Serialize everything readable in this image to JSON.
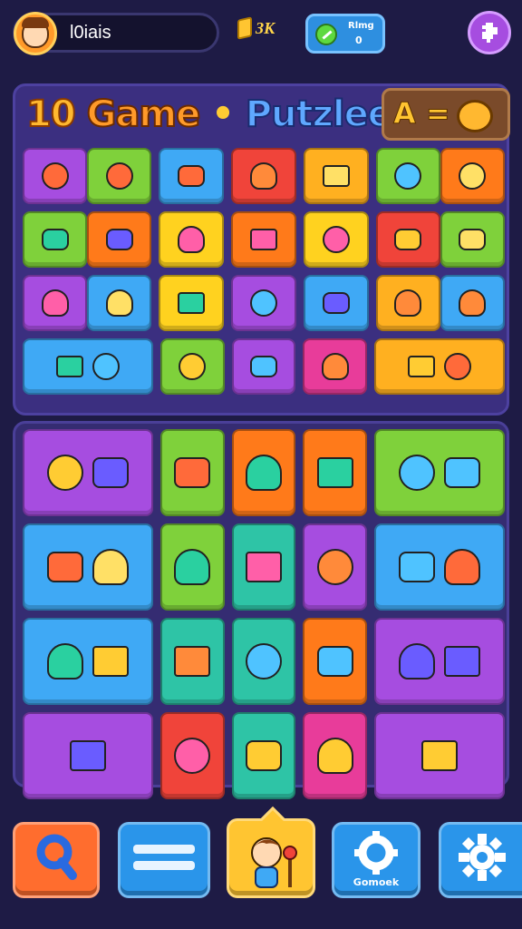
{
  "header": {
    "player_name": "l0iais",
    "currency_value": "ЗК",
    "gem_box": {
      "label": "Rlmg",
      "value": "0"
    }
  },
  "panel": {
    "title_number": "10",
    "title_game": "Game",
    "title_dot": "•",
    "title_word": "Putzlee",
    "badge_text": "A ="
  },
  "colors": {
    "background": "#1e1b45",
    "panel": "#3b2f80",
    "accent_orange": "#ff9a2a",
    "accent_blue": "#5fa8ff",
    "tile_palette": [
      "#a64de0",
      "#7fd13b",
      "#3fa9f5",
      "#f0443a",
      "#ffb020",
      "#ff7a1a",
      "#ffd21f",
      "#e83c9a",
      "#2ec4a6"
    ]
  },
  "grid_top": [
    [
      {
        "c": "#a64de0",
        "icons": [
          "lamp-icon"
        ],
        "c2": "#7fd13b",
        "icons2": [
          "tool-icon"
        ]
      },
      {
        "c": "#3fa9f5",
        "icons": [
          "bag-icon"
        ]
      },
      {
        "c": "#f0443a",
        "icons": [
          "cassette-icon"
        ]
      },
      {
        "c": "#ffb020",
        "icons": [
          "table-icon"
        ]
      },
      {
        "c": "#7fd13b",
        "icons": [
          "paper-icon"
        ],
        "c2": "#ff7a1a",
        "icons2": [
          "card-icon"
        ]
      }
    ],
    [
      {
        "c": "#7fd13b",
        "icons": [
          "cross-icon"
        ],
        "c2": "#ff7a1a",
        "icons2": [
          "book-icon"
        ]
      },
      {
        "c": "#ffd21f",
        "icons": [
          "brush-icon"
        ]
      },
      {
        "c": "#ff7a1a",
        "icons": [
          "lens-icon"
        ]
      },
      {
        "c": "#ffd21f",
        "icons": [
          "car-icon"
        ]
      },
      {
        "c": "#f0443a",
        "icons": [
          "flower-icon"
        ],
        "c2": "#7fd13b",
        "icons2": [
          "cup-icon"
        ]
      }
    ],
    [
      {
        "c": "#a64de0",
        "icons": [
          "torch-icon"
        ],
        "c2": "#3fa9f5",
        "icons2": [
          "hammer-icon"
        ]
      },
      {
        "c": "#ffd21f",
        "icons": [
          "box-icon"
        ]
      },
      {
        "c": "#a64de0",
        "icons": [
          "robot-icon"
        ]
      },
      {
        "c": "#3fa9f5",
        "icons": [
          "popsicle-icon"
        ]
      },
      {
        "c": "#ffb020",
        "icons": [
          "cube-icon"
        ],
        "c2": "#3fa9f5",
        "icons2": [
          "fish-icon"
        ]
      }
    ],
    [
      {
        "c": "#3fa9f5",
        "icons": [
          "kid-icon",
          "photo-icon"
        ],
        "wide": true
      },
      {
        "c": "#7fd13b",
        "icons": [
          "capsule-icon"
        ]
      },
      {
        "c": "#a64de0",
        "icons": [
          "horn-icon"
        ]
      },
      {
        "c": "#e83c9a",
        "icons": [
          "bell-icon"
        ]
      },
      {
        "c": "#ffb020",
        "icons": [
          "girl-icon",
          "ring-icon"
        ],
        "wide": true
      }
    ]
  ],
  "grid_bottom": [
    [
      {
        "c": "#a64de0",
        "icons": [
          "kid-icon",
          "lamp-icon"
        ],
        "wide": true
      },
      {
        "c": "#7fd13b",
        "icons": [
          "bus-icon"
        ]
      },
      {
        "c": "#ff7a1a",
        "icons": [
          "fish-icon"
        ]
      },
      {
        "c": "#ff7a1a",
        "icons": [
          "pen-icon"
        ]
      },
      {
        "c": "#7fd13b",
        "icons": [
          "paper-icon",
          "bulb-icon"
        ],
        "wide": true
      }
    ],
    [
      {
        "c": "#3fa9f5",
        "icons": [
          "kid-icon",
          "rattle-icon"
        ],
        "wide": true
      },
      {
        "c": "#7fd13b",
        "icons": [
          "drum-icon"
        ]
      },
      {
        "c": "#2ec4a6",
        "icons": [
          "seal-icon"
        ]
      },
      {
        "c": "#a64de0",
        "icons": [
          "cheese-icon"
        ]
      },
      {
        "c": "#3fa9f5",
        "icons": [
          "ball-icon",
          "hammer-icon"
        ],
        "wide": true
      }
    ],
    [
      {
        "c": "#3fa9f5",
        "icons": [
          "girl-icon",
          "umbrella-icon"
        ],
        "wide": true
      },
      {
        "c": "#2ec4a6",
        "icons": [
          "balloon-icon"
        ]
      },
      {
        "c": "#2ec4a6",
        "icons": [
          "lemon-icon"
        ]
      },
      {
        "c": "#ff7a1a",
        "icons": [
          "cube-icon"
        ]
      },
      {
        "c": "#a64de0",
        "icons": [
          "monster-icon",
          "bucket-icon"
        ],
        "wide": true
      }
    ],
    [
      {
        "c": "#a64de0",
        "icons": [
          "skateboard-icon"
        ],
        "wide": true
      },
      {
        "c": "#f0443a",
        "icons": [
          "car-icon"
        ]
      },
      {
        "c": "#2ec4a6",
        "icons": [
          "bubble-icon"
        ]
      },
      {
        "c": "#e83c9a",
        "icons": [
          "chest-icon"
        ]
      },
      {
        "c": "#a64de0",
        "icons": [
          "sign-icon"
        ],
        "wide": true
      }
    ]
  ],
  "nav": {
    "gear_label": "Gomoek"
  }
}
